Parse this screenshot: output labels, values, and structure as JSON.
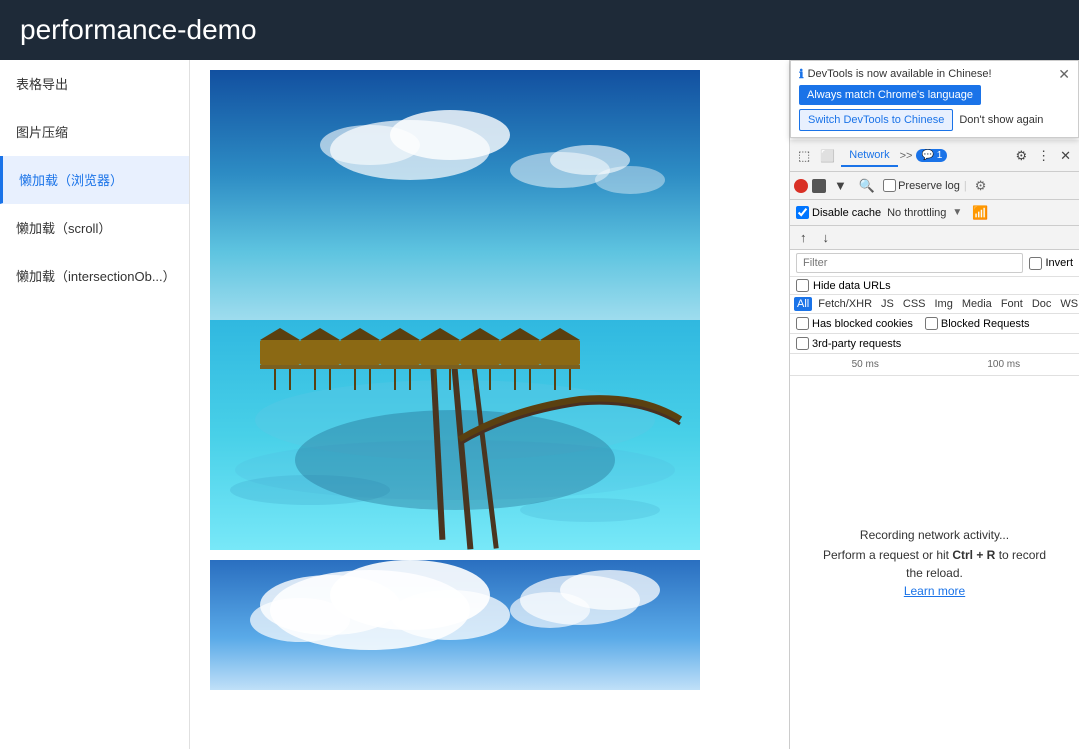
{
  "topbar": {
    "title": "performance-demo"
  },
  "sidebar": {
    "items": [
      {
        "id": "table-export",
        "label": "表格导出"
      },
      {
        "id": "image-compress",
        "label": "图片压缩"
      },
      {
        "id": "lazy-load-browser",
        "label": "懒加载（浏览器）",
        "active": true
      },
      {
        "id": "lazy-load-scroll",
        "label": "懒加载（scroll）"
      },
      {
        "id": "lazy-load-intersection",
        "label": "懒加载（intersectionOb...）"
      }
    ]
  },
  "notification": {
    "info_text": "DevTools is now available in Chinese!",
    "btn_match": "Always match Chrome's language",
    "btn_switch": "Switch DevTools to Chinese",
    "btn_dont_show": "Don't show again"
  },
  "devtools": {
    "tabs": [
      "Network"
    ],
    "active_tab": "Network",
    "badge": "1",
    "toolbar2": {
      "preserve_cache_label": "Preserve log",
      "preserve_cache_checked": false
    },
    "toolbar3": {
      "disable_cache_label": "Disable cache",
      "disable_cache_checked": true,
      "throttle_label": "No throttling"
    },
    "filter": {
      "placeholder": "Filter",
      "invert_label": "Invert"
    },
    "hide_data_urls": "Hide data URLs",
    "type_filters": [
      "All",
      "Fetch/XHR",
      "JS",
      "CSS",
      "Img",
      "Media",
      "Font",
      "Doc",
      "WS"
    ],
    "active_type": "All",
    "has_blocked_cookies": "Has blocked cookies",
    "blocked_requests": "Blocked Requests",
    "third_party": "3rd-party requests",
    "timeline": {
      "label1": "50 ms",
      "label2": "100 ms"
    },
    "network_empty": {
      "line1": "Recording network activity...",
      "line2": "Perform a request or hit",
      "shortcut": "Ctrl + R",
      "line2_end": "to record",
      "line3": "the reload.",
      "learn_more": "Learn more"
    }
  }
}
